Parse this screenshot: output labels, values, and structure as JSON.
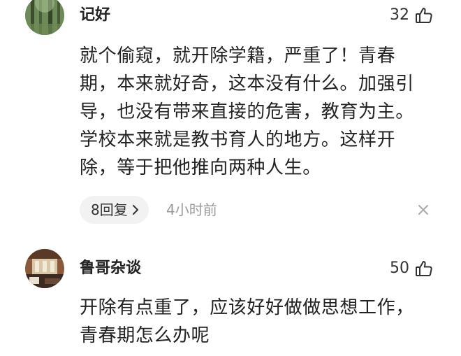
{
  "comments": [
    {
      "username": "记好",
      "likes": "32",
      "avatar_icon": "forest-avatar-icon",
      "text_lines": [
        "就个偷窥，就开除学籍，严重了！青春",
        "期，本来就好奇，这本没有什么。加强引",
        "导，也没有带来直接的危害，教育为主。",
        "学校本来就是教书育人的地方。这样开",
        "除，等于把他推向两种人生。"
      ],
      "reply_label": "8回复",
      "time": "4小时前"
    },
    {
      "username": "鲁哥杂谈",
      "likes": "50",
      "avatar_icon": "room-avatar-icon",
      "text_lines": [
        "开除有点重了，应该好好做做思想工作，",
        "青春期怎么办呢"
      ]
    }
  ],
  "icons": {
    "like": "thumbs-up-icon",
    "chevron": "chevron-right-icon",
    "close": "close-icon"
  },
  "colors": {
    "text": "#222222",
    "muted": "#999999",
    "pill_bg": "#f2f2f2"
  }
}
